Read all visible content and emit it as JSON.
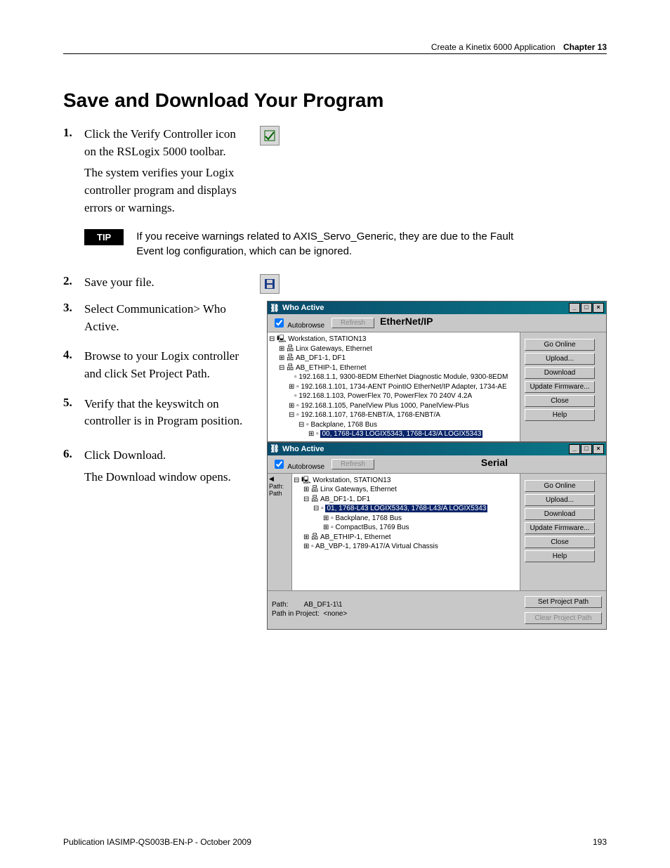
{
  "header": {
    "title": "Create a Kinetix 6000 Application",
    "chapter_label": "Chapter 13"
  },
  "heading": "Save and Download Your Program",
  "steps": {
    "s1": {
      "num": "1.",
      "text": "Click the Verify Controller icon on the RSLogix 5000 toolbar.",
      "sub": "The system verifies your Logix controller program and displays errors or warnings."
    },
    "s2": {
      "num": "2.",
      "text": "Save your file."
    },
    "s3": {
      "num": "3.",
      "text": "Select Communication> Who Active."
    },
    "s4": {
      "num": "4.",
      "text": "Browse to your Logix controller and click Set Project Path."
    },
    "s5": {
      "num": "5.",
      "text": "Verify that the keyswitch on controller is in Program position."
    },
    "s6": {
      "num": "6.",
      "text": "Click Download.",
      "sub": "The Download window opens."
    }
  },
  "tip": {
    "badge": "TIP",
    "text": "If you receive warnings related to AXIS_Servo_Generic, they are due to the Fault Event log configuration, which can be ignored."
  },
  "win1": {
    "title": "Who Active",
    "net_label": "EtherNet/IP",
    "autobrowse": "Autobrowse",
    "refresh": "Refresh",
    "tree": {
      "l0": "Workstation, STATION13",
      "l1": "Linx Gateways, Ethernet",
      "l2": "AB_DF1-1, DF1",
      "l3": "AB_ETHIP-1, Ethernet",
      "l4": "192.168.1.1, 9300-8EDM EtherNet Diagnostic Module, 9300-8EDM",
      "l5": "192.168.1.101, 1734-AENT PointIO EtherNet/IP Adapter, 1734-AE",
      "l6": "192.168.1.103, PowerFlex 70, PowerFlex 70   240V   4.2A",
      "l7": "192.168.1.105, PanelView Plus 1000, PanelView-Plus",
      "l8": "192.168.1.107, 1768-ENBT/A, 1768-ENBT/A",
      "l9": "Backplane, 1768 Bus",
      "l10": "00, 1768-L43 LOGIX5343, 1768-L43/A LOGIX5343"
    },
    "buttons": {
      "go_online": "Go Online",
      "upload": "Upload...",
      "download": "Download",
      "update_fw": "Update Firmware...",
      "close": "Close",
      "help": "Help"
    }
  },
  "win2": {
    "title": "Who Active",
    "net_label": "Serial",
    "autobrowse": "Autobrowse",
    "refresh": "Refresh",
    "side_label": "Path: Path",
    "tree": {
      "l0": "Workstation, STATION13",
      "l1": "Linx Gateways, Ethernet",
      "l2": "AB_DF1-1, DF1",
      "l3": "01, 1768-L43 LOGIX5343, 1768-L43/A LOGIX5343",
      "l4": "Backplane, 1768 Bus",
      "l5": "CompactBus, 1769 Bus",
      "l6": "AB_ETHIP-1, Ethernet",
      "l7": "AB_VBP-1, 1789-A17/A Virtual Chassis"
    },
    "buttons": {
      "go_online": "Go Online",
      "upload": "Upload...",
      "download": "Download",
      "update_fw": "Update Firmware...",
      "close": "Close",
      "help": "Help",
      "set_path": "Set Project Path",
      "clear_path": "Clear Project Path"
    },
    "path_label": "Path:",
    "path_value": "AB_DF1-1\\1",
    "proj_label": "Path in Project:",
    "proj_value": "<none>"
  },
  "footer": {
    "pub": "Publication IASIMP-QS003B-EN-P - October 2009",
    "page": "193"
  }
}
